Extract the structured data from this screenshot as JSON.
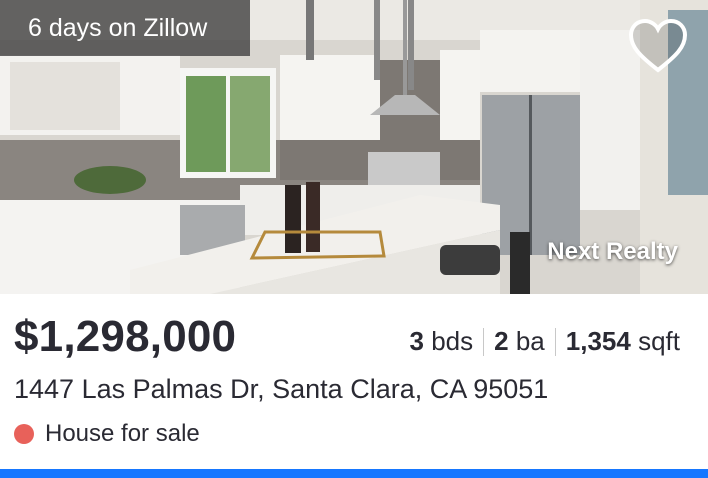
{
  "listing": {
    "days_badge": "6 days on Zillow",
    "favorite_icon": "heart-outline-icon",
    "brokerage": "Next Realty",
    "price": "$1,298,000",
    "beds_value": "3",
    "beds_unit": "bds",
    "baths_value": "2",
    "baths_unit": "ba",
    "sqft_value": "1,354",
    "sqft_unit": "sqft",
    "address": "1447 Las Palmas Dr, Santa Clara, CA 95051",
    "status": "House for sale",
    "status_color": "#e8615a",
    "accent_color": "#1677ff"
  }
}
